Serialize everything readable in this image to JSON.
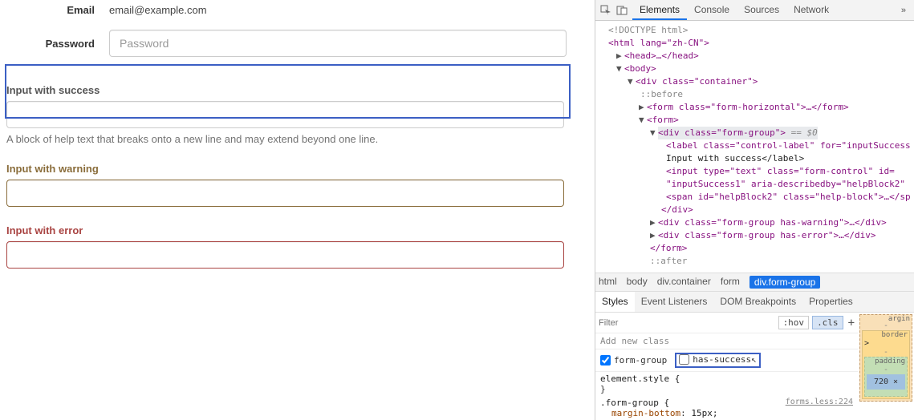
{
  "form": {
    "email_label": "Email",
    "email_value": "email@example.com",
    "password_label": "Password",
    "password_placeholder": "Password",
    "success": {
      "label": "Input with success",
      "help": "A block of help text that breaks onto a new line and may extend beyond one line."
    },
    "warning": {
      "label": "Input with warning"
    },
    "error": {
      "label": "Input with error"
    }
  },
  "devtools": {
    "tabs": {
      "elements": "Elements",
      "console": "Console",
      "sources": "Sources",
      "network": "Network",
      "more": "»"
    },
    "tree": {
      "doctype": "<!DOCTYPE html>",
      "html_open": "<html lang=\"zh-CN\">",
      "head": "<head>…</head>",
      "body": "<body>",
      "container": "<div class=\"container\">",
      "before": "::before",
      "form_horiz": "<form class=\"form-horizontal\">…</form>",
      "form": "<form>",
      "formgroup": "<div class=\"form-group\">",
      "eq0": " == $0",
      "label": "<label class=\"control-label\" for=\"inputSuccess",
      "labeltext": "Input with success</label>",
      "input": "<input type=\"text\" class=\"form-control\" id=",
      "input2": "\"inputSuccess1\" aria-describedby=\"helpBlock2\"",
      "span": "<span id=\"helpBlock2\" class=\"help-block\">…</sp",
      "divclose": "</div>",
      "warning_div": "<div class=\"form-group has-warning\">…</div>",
      "error_div": "<div class=\"form-group has-error\">…</div>",
      "formclose": "</form>",
      "after": "::after"
    },
    "crumbs": {
      "c1": "html",
      "c2": "body",
      "c3": "div.container",
      "c4": "form",
      "c5": "div.form-group"
    },
    "styles_tabs": {
      "styles": "Styles",
      "listeners": "Event Listeners",
      "dom": "DOM Breakpoints",
      "props": "Properties"
    },
    "filter": {
      "placeholder": "Filter",
      "hov": ":hov",
      "cls": ".cls",
      "plus": "+"
    },
    "addclass": "Add new class",
    "chk1": "form-group",
    "chk2": "has-success",
    "rules": {
      "elstyle": "element.style {",
      "close": "}",
      "fg_sel": ".form-group {",
      "fg_link": "forms.less:224",
      "fg_prop_n": "margin-bottom",
      "fg_prop_v": "15px;"
    },
    "boxmodel": {
      "margin": "argin",
      "border": "border",
      "padding": "padding",
      "content": "720 ×",
      "dash": "-"
    }
  }
}
